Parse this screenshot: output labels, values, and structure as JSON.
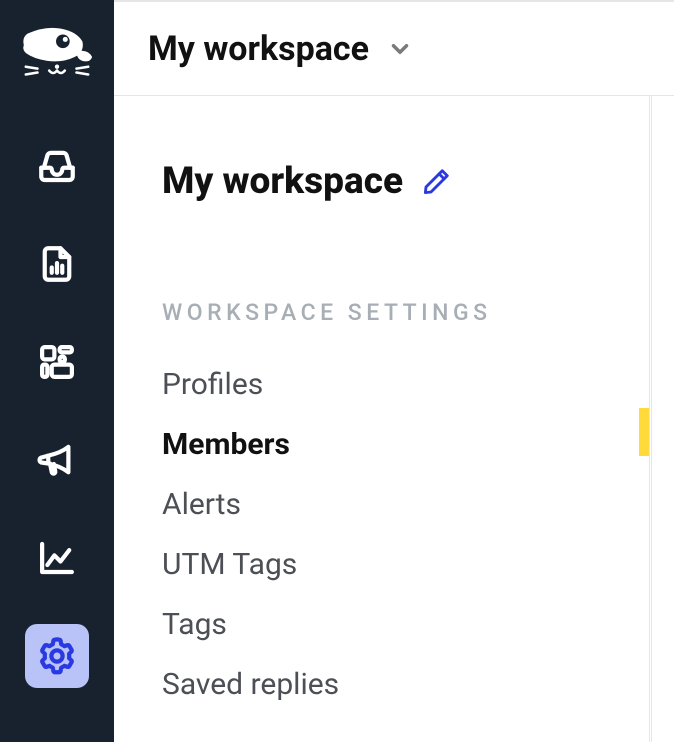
{
  "rail": {
    "items": [
      {
        "name": "inbox"
      },
      {
        "name": "reports"
      },
      {
        "name": "apps"
      },
      {
        "name": "announcements"
      },
      {
        "name": "analytics"
      },
      {
        "name": "settings",
        "active": true
      }
    ]
  },
  "topbar": {
    "title": "My workspace"
  },
  "panel": {
    "title": "My workspace",
    "section_label": "WORKSPACE SETTINGS",
    "menu": [
      {
        "label": "Profiles",
        "selected": false
      },
      {
        "label": "Members",
        "selected": true
      },
      {
        "label": "Alerts",
        "selected": false
      },
      {
        "label": "UTM Tags",
        "selected": false
      },
      {
        "label": "Tags",
        "selected": false
      },
      {
        "label": "Saved replies",
        "selected": false
      }
    ]
  }
}
